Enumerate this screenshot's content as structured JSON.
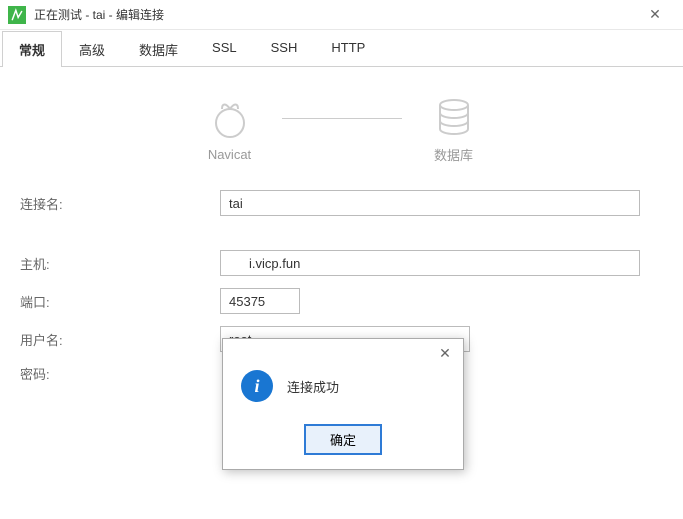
{
  "window": {
    "title": "正在测试 - tai - 编辑连接"
  },
  "tabs": [
    "常规",
    "高级",
    "数据库",
    "SSL",
    "SSH",
    "HTTP"
  ],
  "hero": {
    "left": "Navicat",
    "right": "数据库"
  },
  "form": {
    "connection_label": "连接名:",
    "connection_value": "tai",
    "host_label": "主机:",
    "host_value": "i.vicp.fun",
    "port_label": "端口:",
    "port_value": "45375",
    "user_label": "用户名:",
    "user_value": "root",
    "pass_label": "密码:"
  },
  "modal": {
    "message": "连接成功",
    "ok": "确定"
  }
}
